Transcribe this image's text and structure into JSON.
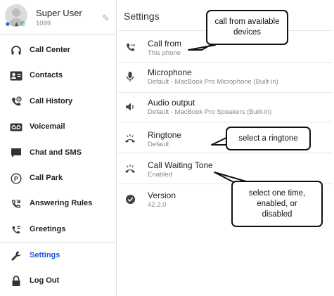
{
  "profile": {
    "name": "Super User",
    "extension": "1099"
  },
  "sidebar": {
    "items": [
      {
        "label": "Call Center",
        "icon": "headset-icon"
      },
      {
        "label": "Contacts",
        "icon": "contact-card-icon"
      },
      {
        "label": "Call History",
        "icon": "call-history-icon"
      },
      {
        "label": "Voicemail",
        "icon": "voicemail-icon"
      },
      {
        "label": "Chat and SMS",
        "icon": "chat-icon"
      },
      {
        "label": "Call Park",
        "icon": "parking-icon"
      },
      {
        "label": "Answering Rules",
        "icon": "answering-rules-icon"
      },
      {
        "label": "Greetings",
        "icon": "greetings-icon"
      },
      {
        "label": "Settings",
        "icon": "wrench-icon"
      },
      {
        "label": "Log Out",
        "icon": "lock-icon"
      }
    ],
    "active": "Settings",
    "active_color": "#1e5bd8"
  },
  "main": {
    "title": "Settings",
    "settings": [
      {
        "title": "Call from",
        "subtitle": "This phone",
        "icon": "phone-icon"
      },
      {
        "title": "Microphone",
        "subtitle": "Default - MacBook Pro Microphone (Built-in)",
        "icon": "microphone-icon"
      },
      {
        "title": "Audio output",
        "subtitle": "Default - MacBook Pro Speakers (Built-in)",
        "icon": "speaker-icon"
      },
      {
        "title": "Ringtone",
        "subtitle": "Default",
        "icon": "ringing-phone-icon"
      },
      {
        "title": "Call Waiting Tone",
        "subtitle": "Enabled",
        "icon": "ringing-phone-icon"
      },
      {
        "title": "Version",
        "subtitle": "42.2.0",
        "icon": "check-circle-icon"
      }
    ]
  },
  "callouts": {
    "call_from": "call from available devices",
    "ringtone": "select a ringtone",
    "waiting_tone": "select one time, enabled, or disabled"
  }
}
